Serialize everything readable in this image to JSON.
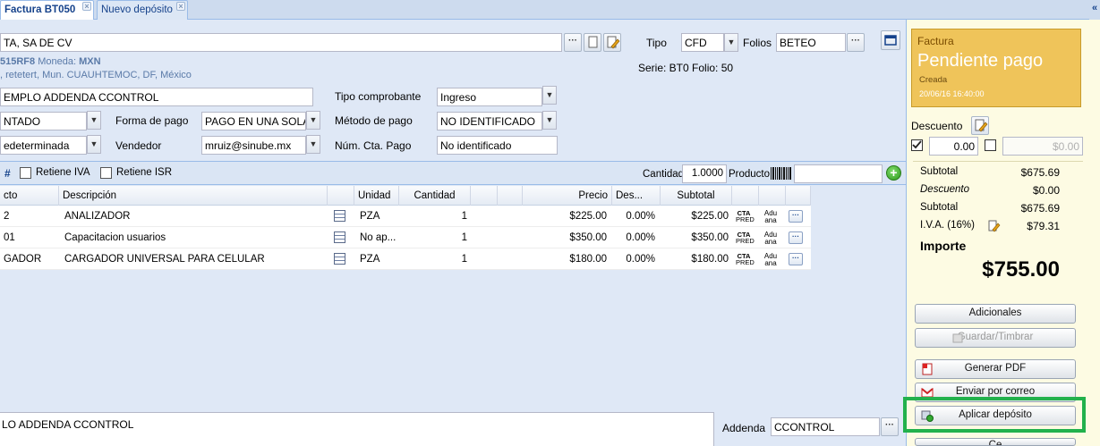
{
  "tabs": [
    {
      "label": "Factura BT050",
      "active": true
    },
    {
      "label": "Nuevo depósito",
      "active": false
    }
  ],
  "header": {
    "client_name": "TA, SA DE CV",
    "rfc": "515RF8",
    "moneda_label": "Moneda:",
    "moneda_value": "MXN",
    "address": ", retetert, Mun. CUAUHTEMOC, DF, México",
    "tipo_label": "Tipo",
    "tipo_value": "CFD",
    "folios_label": "Folios",
    "folios_value": "BETEO",
    "serie_folio": "Serie: BT0 Folio: 50",
    "addenda_name": "EMPLO ADDENDA CCONTROL",
    "condiciones_value": "NTADO",
    "forma_pago_label": "Forma de pago",
    "forma_pago_value": "PAGO EN UNA SOLA",
    "tipo_comprobante_label": "Tipo comprobante",
    "tipo_comprobante_value": "Ingreso",
    "metodo_pago_label": "Método de pago",
    "metodo_pago_value": "NO IDENTIFICADO",
    "almacen_value": "edeterminada",
    "vendedor_label": "Vendedor",
    "vendedor_value": "mruiz@sinube.mx",
    "num_cta_label": "Núm. Cta. Pago",
    "num_cta_value": "No identificado"
  },
  "grid_toolbar": {
    "hash": "#",
    "retiene_iva": "Retiene IVA",
    "retiene_isr": "Retiene ISR",
    "cantidad_label": "Cantidad",
    "cantidad_value": "1.0000",
    "producto_label": "Producto",
    "producto_value": ""
  },
  "grid": {
    "columns": [
      "cto",
      "Descripción",
      "Unidad",
      "Cantidad",
      "Precio",
      "Des...",
      "Subtotal"
    ],
    "rows": [
      {
        "code": "2",
        "desc": "ANALIZADOR",
        "unit": "PZA",
        "qty": "1",
        "price": "$225.00",
        "disc": "0.00%",
        "subtotal": "$225.00",
        "cta1": "CTA",
        "cta2": "PRED",
        "adu1": "Adu",
        "adu2": "ana"
      },
      {
        "code": "01",
        "desc": "Capacitacion usuarios",
        "unit": "No ap...",
        "qty": "1",
        "price": "$350.00",
        "disc": "0.00%",
        "subtotal": "$350.00",
        "cta1": "CTA",
        "cta2": "PRED",
        "adu1": "Adu",
        "adu2": "ana"
      },
      {
        "code": "GADOR",
        "desc": "CARGADOR UNIVERSAL PARA CELULAR",
        "unit": "PZA",
        "qty": "1",
        "price": "$180.00",
        "disc": "0.00%",
        "subtotal": "$180.00",
        "cta1": "CTA",
        "cta2": "PRED",
        "adu1": "Adu",
        "adu2": "ana"
      }
    ]
  },
  "bottom": {
    "addenda_text": "LO ADDENDA CCONTROL",
    "addenda_label": "Addenda",
    "addenda_value": "CCONTROL"
  },
  "status": {
    "doc_type": "Factura",
    "state": "Pendiente pago",
    "sub": "Creada",
    "date": "20/06/16 16:40:00"
  },
  "summary": {
    "descuento_label": "Descuento",
    "descuento_value": "0.00",
    "descuento_pct": "$0.00",
    "subtotal_label": "Subtotal",
    "subtotal_value": "$675.69",
    "descuento2_label": "Descuento",
    "descuento2_value": "$0.00",
    "subtotal2_label": "Subtotal",
    "subtotal2_value": "$675.69",
    "iva_label": "I.V.A. (16%)",
    "iva_value": "$79.31",
    "importe_label": "Importe",
    "importe_value": "$755.00"
  },
  "actions": {
    "adicionales": "Adicionales",
    "guardar": "Guardar/Timbrar",
    "generar_pdf": "Generar PDF",
    "enviar_correo": "Enviar por correo",
    "aplicar_deposito": "Aplicar depósito",
    "cerrar": "Ce"
  },
  "colors": {
    "accent": "#15428b",
    "status_card": "#efc45a",
    "highlight": "#22b14c"
  }
}
